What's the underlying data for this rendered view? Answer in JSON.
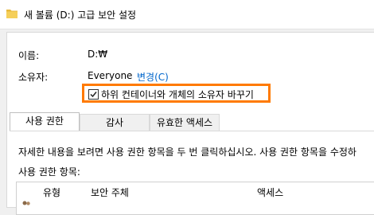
{
  "window": {
    "title": "새 볼륨 (D:) 고급 보안 설정",
    "icon": "folder-icon"
  },
  "info": {
    "name_label": "이름:",
    "name_value": "D:₩",
    "owner_label": "소유자:",
    "owner_value": "Everyone",
    "change_link": "변경(C)"
  },
  "replace_owner": {
    "label": "하위 컨테이너와 개체의 소유자 바꾸기",
    "checked": true,
    "highlight_color": "#ff7a00"
  },
  "tabs": [
    {
      "label": "사용 권한",
      "active": true
    },
    {
      "label": "감사",
      "active": false
    },
    {
      "label": "유효한 액세스",
      "active": false
    }
  ],
  "description": "자세한 내용을 보려면 사용 권한 항목을 두 번 클릭하십시오. 사용 권한 항목을 수정하",
  "entries_label": "사용 권한 항목:",
  "table": {
    "columns": [
      "유형",
      "보안 주체",
      "액세스"
    ]
  },
  "colors": {
    "link": "#0066cc",
    "folder": "#e8b93c"
  }
}
